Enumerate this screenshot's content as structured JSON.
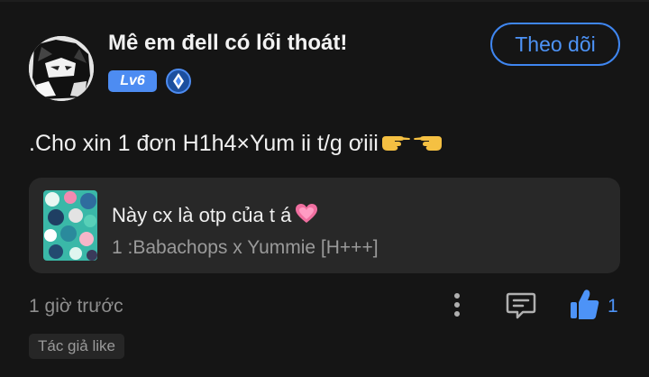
{
  "post": {
    "author": {
      "name": "Mê em đell có lối thoát!",
      "level": "Lv6",
      "verified_icon": "diamond-badge-icon"
    },
    "follow_label": "Theo dõi",
    "text": ".Cho xin 1 đơn H1h4×Yum ii t/g ơiii",
    "trailing_emoji": [
      "pointing-right-hand-emoji",
      "pointing-left-hand-emoji"
    ],
    "shared": {
      "title": "Này cx là otp của t á",
      "title_emoji": "heart-emoji",
      "subtitle": "1 :Babachops x Yummie [H+++]"
    },
    "footer": {
      "timestamp": "1 giờ trước",
      "more_icon": "more-vertical-icon",
      "comment_icon": "comment-icon",
      "like_icon": "thumbs-up-icon",
      "like_count": "1"
    },
    "author_like_tag": "Tác giả like"
  },
  "colors": {
    "background": "#151515",
    "card": "#282828",
    "accent": "#4d93f7",
    "level_badge": "#4d8cf2",
    "muted_text": "#8e8e8e"
  }
}
